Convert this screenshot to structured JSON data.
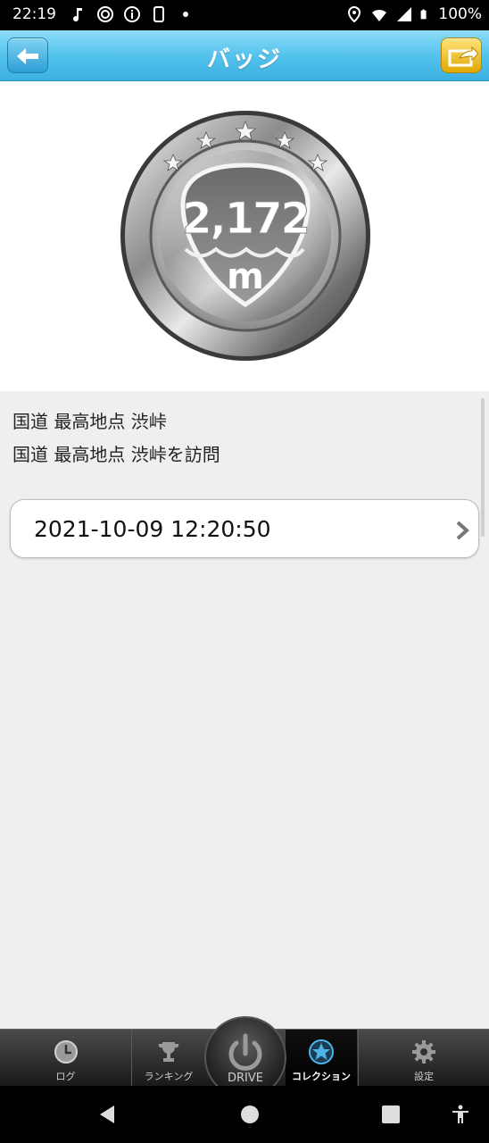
{
  "status_bar": {
    "time": "22:19",
    "battery": "100%",
    "icons": [
      "music-note-icon",
      "wifi-icon",
      "info-icon",
      "phone-icon",
      "dot-icon",
      "location-icon",
      "wifi-strength-icon",
      "signal-icon",
      "battery-icon"
    ]
  },
  "header": {
    "title": "バッジ",
    "back_icon": "arrow-left-icon",
    "share_icon": "share-arrow-icon"
  },
  "badge": {
    "value": "2,172",
    "unit": "m"
  },
  "content": {
    "line1": "国道 最高地点 渋峠",
    "line2": "国道 最高地点 渋峠を訪問",
    "record_date": "2021-10-09 12:20:50"
  },
  "tabs": [
    {
      "label": "ログ",
      "icon": "clock-icon"
    },
    {
      "label": "ランキング",
      "icon": "trophy-icon"
    },
    {
      "label": "DRIVE",
      "icon": "power-icon"
    },
    {
      "label": "コレクション",
      "icon": "star-icon"
    },
    {
      "label": "設定",
      "icon": "gear-icon"
    }
  ],
  "colors": {
    "header": "#54c3ee",
    "share_button": "#f0c020",
    "content_bg": "#efefef",
    "tab_selected": "#4ab4e6"
  }
}
